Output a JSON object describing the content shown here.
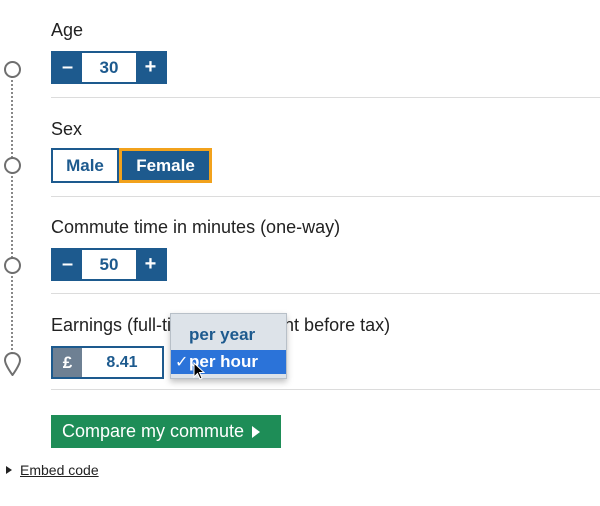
{
  "age": {
    "label": "Age",
    "value": "30",
    "minus": "–",
    "plus": "+"
  },
  "sex": {
    "label": "Sex",
    "options": [
      "Male",
      "Female"
    ],
    "selected": "Female"
  },
  "commute": {
    "label": "Commute time in minutes (one-way)",
    "value": "50",
    "minus": "–",
    "plus": "+"
  },
  "earnings": {
    "label": "Earnings (full-ti",
    "label_tail": "nt before tax)",
    "currency": "£",
    "value": "8.41",
    "period_options": [
      "per year",
      "per hour"
    ],
    "selected_period": "per hour",
    "check": "✓"
  },
  "compare_button": "Compare my commute",
  "embed_code": "Embed code",
  "colors": {
    "primary": "#1d5a8e",
    "accent": "#f2a21c",
    "compare": "#1e8d57",
    "highlight": "#2b73d9"
  }
}
